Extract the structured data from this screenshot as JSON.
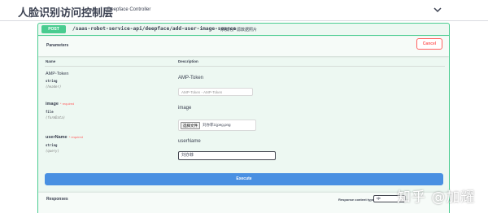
{
  "tag": {
    "title": "人脸识别访问控制层",
    "description": "Deepface Controller",
    "chevron_icon": "chevron-down-icon"
  },
  "operation": {
    "method": "POST",
    "path": "/saas-robot-service-api/deepface/add-user-image-source",
    "summary": "添加用户源数据照片",
    "method_color": "#49cc90"
  },
  "parameters": {
    "title": "Parameters",
    "cancel_label": "Cancel",
    "col_name": "Name",
    "col_description": "Description",
    "items": [
      {
        "name": "AMP-Token",
        "required": "",
        "type": "string",
        "in": "(header)",
        "description": "AMP-Token",
        "input_placeholder": "AMP-Token - AMP-Token",
        "input_value": ""
      },
      {
        "name": "image",
        "required": "* required",
        "type": "file",
        "in": "(formData)",
        "description": "image",
        "file_button": "选择文件",
        "file_name": "刘亦菲3.jpeg.png"
      },
      {
        "name": "userName",
        "required": "* required",
        "type": "string",
        "in": "(query)",
        "description": "userName",
        "input_value": "刘亦菲"
      }
    ]
  },
  "execute_label": "Execute",
  "execute_color": "#4990e2",
  "responses": {
    "title": "Responses",
    "content_type_label": "Response content type",
    "content_type_value": "*/*"
  },
  "watermark": "知乎 @加耀"
}
